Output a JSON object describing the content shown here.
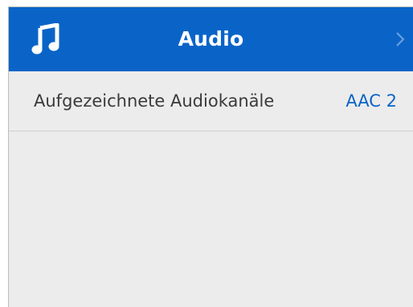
{
  "header": {
    "icon": "music-note-icon",
    "title": "Audio",
    "nav_icon": "chevron-right-icon",
    "background_color": "#0a64c8"
  },
  "settings": [
    {
      "label": "Aufgezeichnete Audiokanäle",
      "value": "AAC 2",
      "value_color": "#0a64c8"
    }
  ]
}
